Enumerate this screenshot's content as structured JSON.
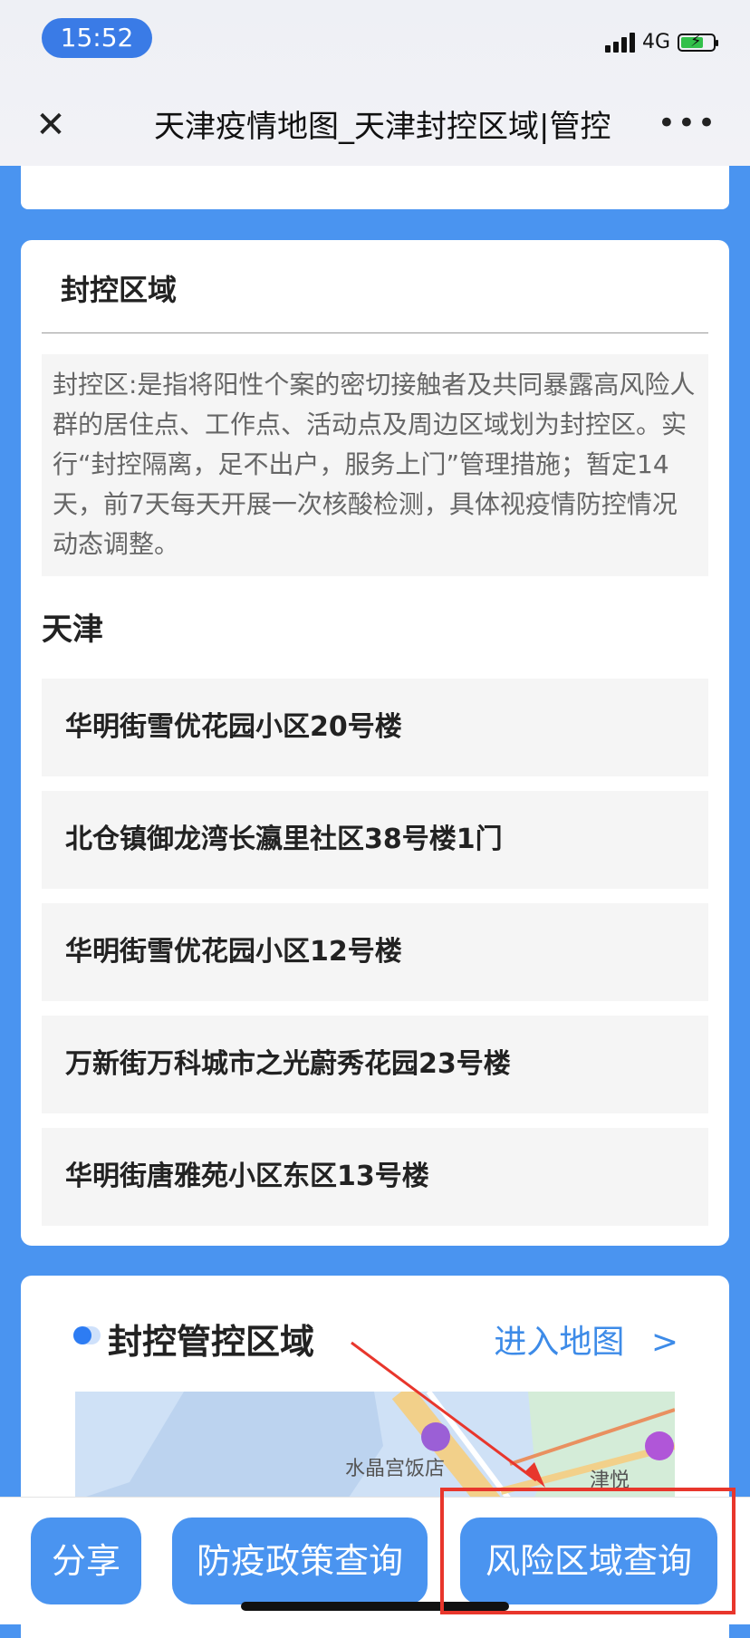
{
  "status_bar": {
    "time": "15:52",
    "network": "4G"
  },
  "nav": {
    "title": "天津疫情地图_天津封控区域|管控",
    "close_icon": "close-icon",
    "more_icon": "more-icon"
  },
  "section": {
    "title": "封控区域",
    "description": "封控区:是指将阳性个案的密切接触者及共同暴露高风险人群的居住点、工作点、活动点及周边区域划为封控区。实行“封控隔离，足不出户，服务上门”管理措施；暂定14天，前7天每天开展一次核酸检测，具体视疫情防控情况动态调整。",
    "city": "天津",
    "items": [
      {
        "label": "华明街雪优花园小区20号楼"
      },
      {
        "label": "北仓镇御龙湾长瀛里社区38号楼1门"
      },
      {
        "label": "华明街雪优花园小区12号楼"
      },
      {
        "label": "万新街万科城市之光蔚秀花园23号楼"
      },
      {
        "label": "华明街唐雅苑小区东区13号楼"
      }
    ]
  },
  "map_section": {
    "title": "封控管控区域",
    "link_label": "进入地图",
    "link_arrow": ">",
    "poi_1": "水晶宫饭店",
    "poi_2": "津悦"
  },
  "bottom_bar": {
    "share_label": "分享",
    "policy_label": "防疫政策查询",
    "risk_label": "风险区域查询"
  },
  "colors": {
    "page_bg": "#4a94f0",
    "button_bg": "#4a94f0",
    "link": "#3d8be8",
    "highlight": "#e8362c"
  }
}
